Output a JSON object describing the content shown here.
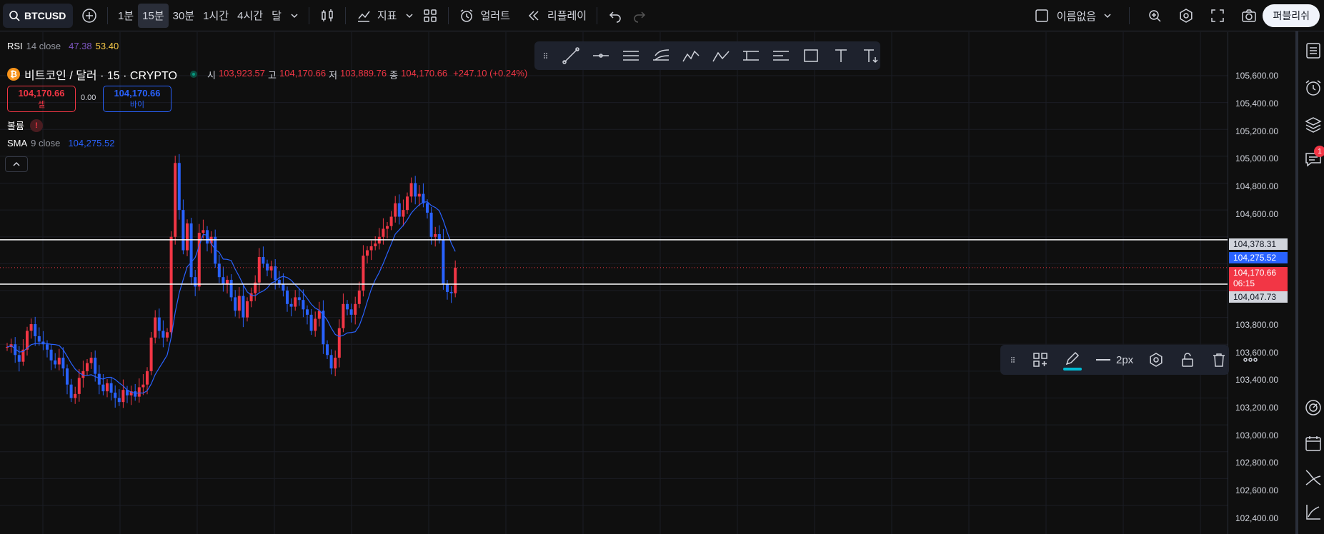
{
  "topbar": {
    "symbol": "BTCUSD",
    "intervals": [
      "1분",
      "15분",
      "30분",
      "1시간",
      "4시간",
      "달"
    ],
    "active_interval": "15분",
    "indicators_label": "지표",
    "alerts_label": "얼러트",
    "replay_label": "리플레이",
    "layout_name": "이름없음",
    "publish_label": "퍼블리쉬"
  },
  "legend": {
    "rsi": {
      "name": "RSI",
      "params": "14 close",
      "value1": "47.38",
      "value2": "53.40"
    },
    "title": "비트코인 / 달러 · 15 · CRYPTO",
    "ohlc": {
      "open_label": "시",
      "open": "103,923.57",
      "high_label": "고",
      "high": "104,170.66",
      "low_label": "저",
      "low": "103,889.76",
      "close_label": "종",
      "close": "104,170.66",
      "change": "+247.10 (+0.24%)"
    },
    "sell": {
      "price": "104,170.66",
      "label": "셀"
    },
    "buy": {
      "price": "104,170.66",
      "label": "바이"
    },
    "spread": "0.00",
    "volume_label": "볼륨",
    "volume_warning": "!",
    "sma": {
      "name": "SMA",
      "params": "9 close",
      "value": "104,275.52"
    }
  },
  "price_axis": {
    "ticks": [
      "105,600.00",
      "105,400.00",
      "105,200.00",
      "105,000.00",
      "104,800.00",
      "104,600.00",
      "103,800.00",
      "103,600.00",
      "103,400.00",
      "103,200.00",
      "103,000.00",
      "102,800.00",
      "102,600.00",
      "102,400.00"
    ],
    "tags": {
      "line_upper": "104,378.31",
      "sma": "104,275.52",
      "last_price": "104,170.66",
      "countdown": "06:15",
      "line_lower": "104,047.73"
    }
  },
  "prop_toolbar": {
    "width_label": "2px"
  },
  "alerts_badge": "1",
  "colors": {
    "up": "#f23645",
    "down": "#2962ff",
    "sma": "#2962ff",
    "bg": "#0f0f0f"
  },
  "chart_data": {
    "type": "candlestick",
    "y_range": [
      102350,
      105700
    ],
    "hlines": [
      104378.31,
      104047.73
    ],
    "last_price": 104170.66
  }
}
